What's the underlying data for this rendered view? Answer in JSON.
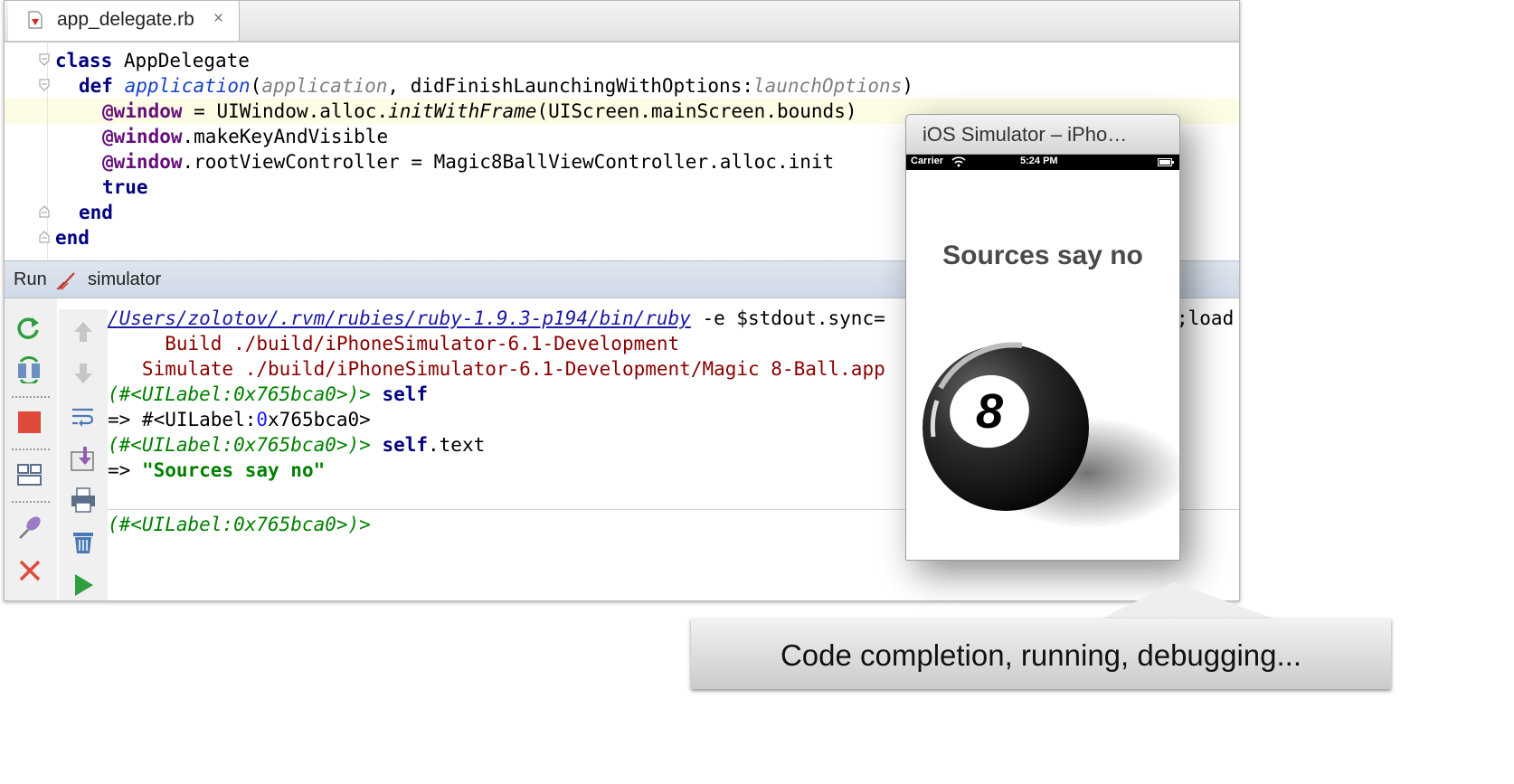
{
  "tab": {
    "filename": "app_delegate.rb",
    "close": "×"
  },
  "code": {
    "l1_kw": "class",
    "l1_rest": " AppDelegate",
    "l2_kw": "def",
    "l2_meth": "application",
    "l2_open": "(",
    "l2_p1": "application",
    "l2_mid": ", didFinishLaunchingWithOptions:",
    "l2_p2": "launchOptions",
    "l2_close": ")",
    "l3_ivar": "@window",
    "l3_a": " = UIWindow.alloc.",
    "l3_it": "initWithFrame",
    "l3_b": "(UIScreen.mainScreen.bounds)",
    "l4_ivar": "@window",
    "l4_rest": ".makeKeyAndVisible",
    "l5_ivar": "@window",
    "l5_rest": ".rootViewController = Magic8BallViewController.alloc.init",
    "l6_kw": "true",
    "l7_kw": "end",
    "l8_kw": "end"
  },
  "run": {
    "label": "Run",
    "config": "simulator"
  },
  "console": {
    "line1_path": "/Users/zolotov/.rvm/rubies/ruby-1.9.3-p194/bin/ruby",
    "line1_args": " -e $stdout.sync=",
    "line1_tail": ";load",
    "line2": "     Build ./build/iPhoneSimulator-6.1-Development",
    "line3": "   Simulate ./build/iPhoneSimulator-6.1-Development/Magic 8-Ball.app",
    "line4_prompt": "(#<UILabel:0x765bca0>)>",
    "line4_cmd": " self",
    "line5_a": "=> #<UILabel:",
    "line5_num": "0",
    "line5_b": "x765bca0>",
    "line6_prompt": "(#<UILabel:0x765bca0>)>",
    "line6_kw": " self",
    "line6_rest": ".text",
    "line7_arrow": "=> ",
    "line7_str": "\"Sources say no\"",
    "input_prompt": "(#<UILabel:0x765bca0>)>"
  },
  "simulator": {
    "title": "iOS Simulator – iPho…",
    "carrier": "Carrier",
    "time": "5:24 PM",
    "answer": "Sources say no",
    "ball_number": "8"
  },
  "callout": "Code completion, running, debugging..."
}
